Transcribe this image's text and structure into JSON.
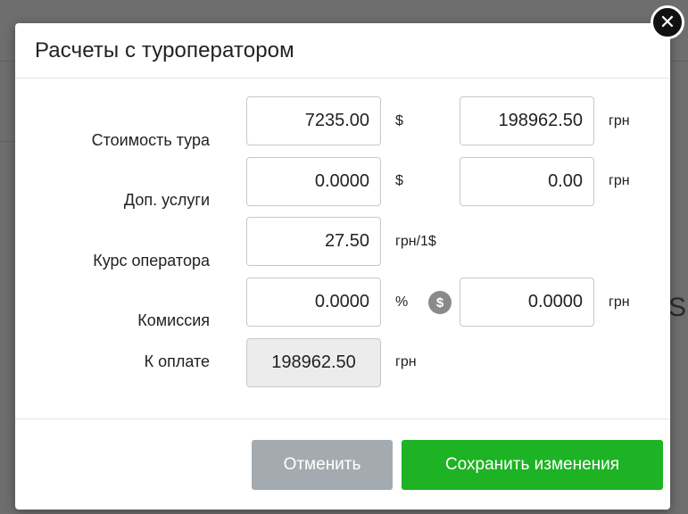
{
  "dialog": {
    "title": "Расчеты с туроператором",
    "close_glyph": "✕"
  },
  "rows": {
    "tour_cost": {
      "label": "Стоимость тура",
      "usd_value": "7235.00",
      "usd_unit": "$",
      "uah_value": "198962.50",
      "uah_unit": "грн"
    },
    "extra_services": {
      "label": "Доп. услуги",
      "usd_value": "0.0000",
      "usd_unit": "$",
      "uah_value": "0.00",
      "uah_unit": "грн"
    },
    "operator_rate": {
      "label": "Курс оператора",
      "value": "27.50",
      "unit": "грн/1$"
    },
    "commission": {
      "label": "Комиссия",
      "percent_value": "0.0000",
      "percent_unit": "%",
      "money_icon_glyph": "$",
      "uah_value": "0.0000",
      "uah_unit": "грн"
    },
    "to_pay": {
      "label": "К оплате",
      "value": "198962.50",
      "unit": "грн"
    }
  },
  "footer": {
    "cancel_label": "Отменить",
    "save_label": "Сохранить изменения"
  },
  "colors": {
    "save_button": "#1db324",
    "cancel_button": "#a4abb0",
    "readonly_field": "#ececec"
  },
  "icons": {
    "close": "close-icon",
    "currency_toggle": "dollar-icon"
  }
}
